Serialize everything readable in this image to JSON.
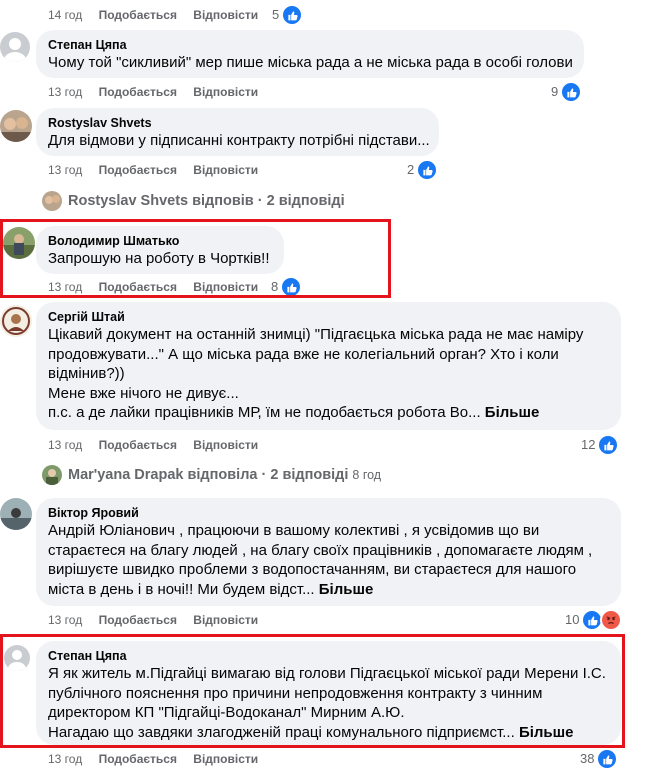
{
  "top_meta": {
    "time": "14 год",
    "like": "Подобається",
    "reply": "Відповісти",
    "count": "5"
  },
  "comments": [
    {
      "author": "Степан Цяпа",
      "lines": [
        "Чому той \"сикливий\" мер пише міська рада а не міська рада в особі голови"
      ],
      "time": "13 год",
      "like": "Подобається",
      "reply": "Відповісти",
      "count": "9"
    },
    {
      "author": "Rostyslav Shvets",
      "lines": [
        "Для відмови у підписанні контракту потрібні підстави..."
      ],
      "time": "13 год",
      "like": "Подобається",
      "reply": "Відповісти",
      "count": "2"
    },
    {
      "author": "Володимир Шматько",
      "lines": [
        "Запрошую на роботу в Чортків!!"
      ],
      "time": "13 год",
      "like": "Подобається",
      "reply": "Відповісти",
      "count": "8"
    },
    {
      "author": "Сергій Штай",
      "lines": [
        "Цікавий документ на останній знимці) \"Підгаєцька міська рада не має наміру",
        "продовжувати...\" А що міська рада вже не колегіальний орган? Хто і коли",
        "відмінив?))",
        "Мене вже нічого не дивує...",
        "п.с. а де лайки працівників МР, їм не подобається робота Во..."
      ],
      "more": "Більше",
      "time": "13 год",
      "like": "Подобається",
      "reply": "Відповісти",
      "count": "12"
    },
    {
      "author": "Віктор Яровий",
      "lines": [
        "Андрій Юліанович , працюючи в вашому колективі , я усвідомив що ви",
        "стараєтеся на благу людей , на благу своїх працівників , допомагаєте людям ,",
        "вирішуєте швидко проблеми з водопостачанням, ви стараєтеся для нашого",
        "міста в день і в ночі!! Ми будем відст..."
      ],
      "more": "Більше",
      "time": "13 год",
      "like": "Подобається",
      "reply": "Відповісти",
      "count": "10"
    },
    {
      "author": "Степан Цяпа",
      "lines": [
        "Я як житель м.Підгайці вимагаю від голови Підгаєцької міської ради Мерени І.С.",
        "публічного пояснення про причини непродовження контракту з чинним",
        "директором КП \"Підгайці-Водоканал\" Мирним А.Ю.",
        "Нагадаю що завдяки злагодженій праці комунального підприємст..."
      ],
      "more": "Більше",
      "time": "13 год",
      "like": "Подобається",
      "reply": "Відповісти",
      "count": "38"
    }
  ],
  "replies_1": {
    "name": "Rostyslav Shvets",
    "text": "відповів · 2 відповіді"
  },
  "replies_2": {
    "name": "Mar'yana Drapak",
    "text": "відповіла · 2 відповіді",
    "time": "8 год"
  },
  "colors": {
    "bubble": "#f0f2f5",
    "meta": "#65676b",
    "like": "#1877f2",
    "highlight": "#e3141b"
  }
}
